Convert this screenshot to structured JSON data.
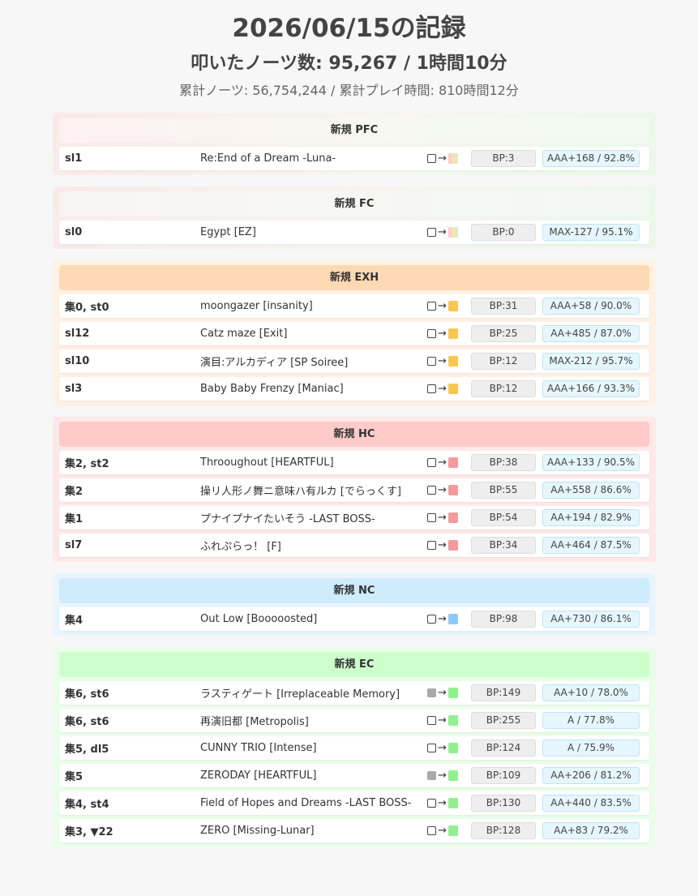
{
  "header": {
    "title": "2026/06/15の記録",
    "subtitle": "叩いたノーツ数: 95,267 / 1時間10分",
    "total": "累計ノーツ: 56,754,244 / 累計プレイ時間: 810時間12分"
  },
  "arrow": "→",
  "colors": {
    "pfc": "#fdeeee",
    "fc": "#f6f6f6",
    "exh": "#ffd9b3",
    "hc": "#ffc8c8",
    "nc": "#cfeeff",
    "ec": "#ccffcc",
    "lamp_exh": "#f9c74f",
    "lamp_hc": "#f59a9a",
    "lamp_nc": "#8fc8f8",
    "lamp_ec": "#90f090"
  },
  "sections": [
    {
      "key": "pfc",
      "title": "新規 PFC",
      "rows": [
        {
          "level": "sl1",
          "song": "Re:End of a Dream -Luna-",
          "from": "none",
          "bp": "BP:3",
          "score": "AAA+168 / 92.8%"
        }
      ]
    },
    {
      "key": "fc",
      "title": "新規 FC",
      "rows": [
        {
          "level": "sl0",
          "song": "Egypt [EZ]",
          "from": "none",
          "bp": "BP:0",
          "score": "MAX-127 / 95.1%"
        }
      ]
    },
    {
      "key": "exh",
      "title": "新規 EXH",
      "rows": [
        {
          "level": "集0, st0",
          "song": "moongazer [insanity]",
          "from": "none",
          "bp": "BP:31",
          "score": "AAA+58 / 90.0%"
        },
        {
          "level": "sl12",
          "song": "Catz maze [Exit]",
          "from": "none",
          "bp": "BP:25",
          "score": "AA+485 / 87.0%"
        },
        {
          "level": "sl10",
          "song": "演目:アルカディア [SP Soiree]",
          "from": "none",
          "bp": "BP:12",
          "score": "MAX-212 / 95.7%"
        },
        {
          "level": "sl3",
          "song": "Baby Baby Frenzy [Maniac]",
          "from": "none",
          "bp": "BP:12",
          "score": "AAA+166 / 93.3%"
        }
      ]
    },
    {
      "key": "hc",
      "title": "新規 HC",
      "rows": [
        {
          "level": "集2, st2",
          "song": "Throoughout [HEARTFUL]",
          "from": "none",
          "bp": "BP:38",
          "score": "AAA+133 / 90.5%"
        },
        {
          "level": "集2",
          "song": "操リ人形ノ舞ニ意味ハ有ルカ [でらっくす]",
          "from": "none",
          "bp": "BP:55",
          "score": "AA+558 / 86.6%"
        },
        {
          "level": "集1",
          "song": "プナイプナイたいそう -LAST BOSS-",
          "from": "none",
          "bp": "BP:54",
          "score": "AA+194 / 82.9%"
        },
        {
          "level": "sl7",
          "song": "ふれぷらっ！ [F]",
          "from": "none",
          "bp": "BP:34",
          "score": "AA+464 / 87.5%"
        }
      ]
    },
    {
      "key": "nc",
      "title": "新規 NC",
      "rows": [
        {
          "level": "集4",
          "song": "Out Low [Booooosted]",
          "from": "none",
          "bp": "BP:98",
          "score": "AA+730 / 86.1%"
        }
      ]
    },
    {
      "key": "ec",
      "title": "新規 EC",
      "rows": [
        {
          "level": "集6, st6",
          "song": "ラスティゲート [Irreplaceable Memory]",
          "from": "gray",
          "bp": "BP:149",
          "score": "AA+10 / 78.0%"
        },
        {
          "level": "集6, st6",
          "song": "再演旧都 [Metropolis]",
          "from": "none",
          "bp": "BP:255",
          "score": "A / 77.8%"
        },
        {
          "level": "集5, dl5",
          "song": "CUNNY TRIO [Intense]",
          "from": "none",
          "bp": "BP:124",
          "score": "A / 75.9%"
        },
        {
          "level": "集5",
          "song": "ZERODAY [HEARTFUL]",
          "from": "gray",
          "bp": "BP:109",
          "score": "AA+206 / 81.2%"
        },
        {
          "level": "集4, st4",
          "song": "Field of Hopes and Dreams -LAST BOSS-",
          "from": "none",
          "bp": "BP:130",
          "score": "AA+440 / 83.5%"
        },
        {
          "level": "集3, ▼22",
          "song": "ZERO [Missing-Lunar]",
          "from": "none",
          "bp": "BP:128",
          "score": "AA+83 / 79.2%"
        }
      ]
    }
  ]
}
